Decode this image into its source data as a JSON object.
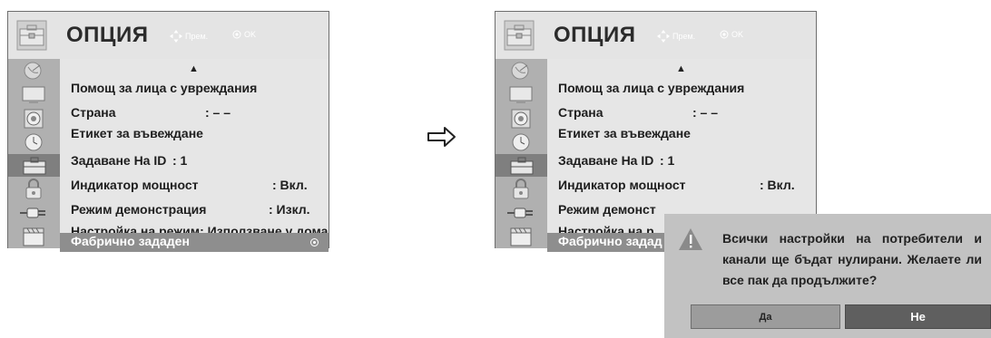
{
  "menu": {
    "title": "ОПЦИЯ",
    "nav_move_label": "Прем.",
    "nav_ok_label": "OK",
    "scroll_up_glyph": "▲",
    "sidebar_icons": [
      "satellite-dish-icon",
      "monitor-icon",
      "speaker-icon",
      "clock-icon",
      "option-toolbox-icon",
      "lock-icon",
      "input-plug-icon",
      "movie-clapper-icon"
    ],
    "rows": [
      {
        "label": "Помощ за лица с увреждания",
        "value": ""
      },
      {
        "label": "Страна",
        "value": ": – –"
      },
      {
        "label": "Етикет за въвеждане",
        "value": ""
      },
      {
        "label": "Задаване На ID",
        "value": ": 1"
      },
      {
        "label": "Индикатор мощност",
        "value": ": Вкл."
      },
      {
        "label": "Режим демонстрация",
        "value": ": Изкл."
      },
      {
        "label": "Настройка на режим: Използване у дома",
        "value": ""
      },
      {
        "label": "Фабрично зададен",
        "value": ""
      }
    ],
    "rows_right_truncated": [
      "Режим демонст",
      "Настройка на р",
      "Фабрично задад"
    ]
  },
  "transition_arrow": "⇨",
  "dialog": {
    "message": "Всички настройки на потребители и канали ще бъдат нулирани. Желаете ли все пак да продължите?",
    "yes_label": "Да",
    "no_label": "Не"
  },
  "colors": {
    "header_bg": "#e4e4e4",
    "content_bg": "#e6e6e6",
    "sidebar_bg": "#b0b0b0",
    "highlight_bg": "#8e8e8e",
    "dialog_bg": "#c2c2c2",
    "no_button_bg": "#5f5f5f"
  }
}
